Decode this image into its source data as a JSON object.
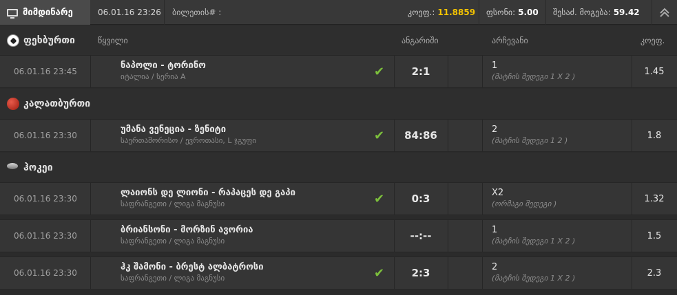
{
  "topbar": {
    "active_tab": "მიმდინარე",
    "datetime": "06.01.16 23:26",
    "ticket_label": "ბილეთის# :",
    "coef_label": "კოეფ.:",
    "coef_value": "11.8859",
    "stake_label": "ფსონი:",
    "stake_value": "5.00",
    "win_label": "შესაძ. მოგება:",
    "win_value": "59.42",
    "collapse_icon": "double-chevron-up-icon"
  },
  "columns": {
    "event": "წყვილი",
    "score": "ანგარიში",
    "pick": "არჩევანი",
    "odd": "კოეფ."
  },
  "sports": [
    {
      "name": "ფეხბურთი",
      "icon": "football-icon",
      "events": [
        {
          "time": "06.01.16 23:45",
          "match": "ნაპოლი - ტორინო",
          "league": "იტალია / სერია A",
          "won": true,
          "score": "2:1",
          "pick": "1",
          "market": "(მატჩის შედეგი 1 X 2 )",
          "odd": "1.45"
        }
      ]
    },
    {
      "name": "კალათბურთი",
      "icon": "basketball-icon",
      "events": [
        {
          "time": "06.01.16 23:30",
          "match": "უმანა ვენეცია - ზენიტი",
          "league": "საერთაშორისო / ევროთასი, L ჯგუფი",
          "won": true,
          "score": "84:86",
          "pick": "2",
          "market": "(მატჩის შედეგი 1 2 )",
          "odd": "1.8"
        }
      ]
    },
    {
      "name": "ჰოკეი",
      "icon": "hockey-puck-icon",
      "events": [
        {
          "time": "06.01.16 23:30",
          "match": "ლაიონს დე ლიონი - რაპაცეს დე გაპი",
          "league": "საფრანგეთი / ლიგა მაგნუსი",
          "won": true,
          "score": "0:3",
          "pick": "X2",
          "market": "(ორმაგი შედეგი )",
          "odd": "1.32"
        },
        {
          "time": "06.01.16 23:30",
          "match": "ბრიანსონი - მორზინ ავორია",
          "league": "საფრანგეთი / ლიგა მაგნუსი",
          "won": false,
          "score": "--:--",
          "pick": "1",
          "market": "(მატჩის შედეგი 1 X 2 )",
          "odd": "1.5"
        },
        {
          "time": "06.01.16 23:30",
          "match": "ჰკ შამონი - ბრესტ ალბატროსი",
          "league": "საფრანგეთი / ლიგა მაგნუსი",
          "won": true,
          "score": "2:3",
          "pick": "2",
          "market": "(მატჩის შედეგი 1 X 2 )",
          "odd": "2.3"
        }
      ]
    }
  ]
}
